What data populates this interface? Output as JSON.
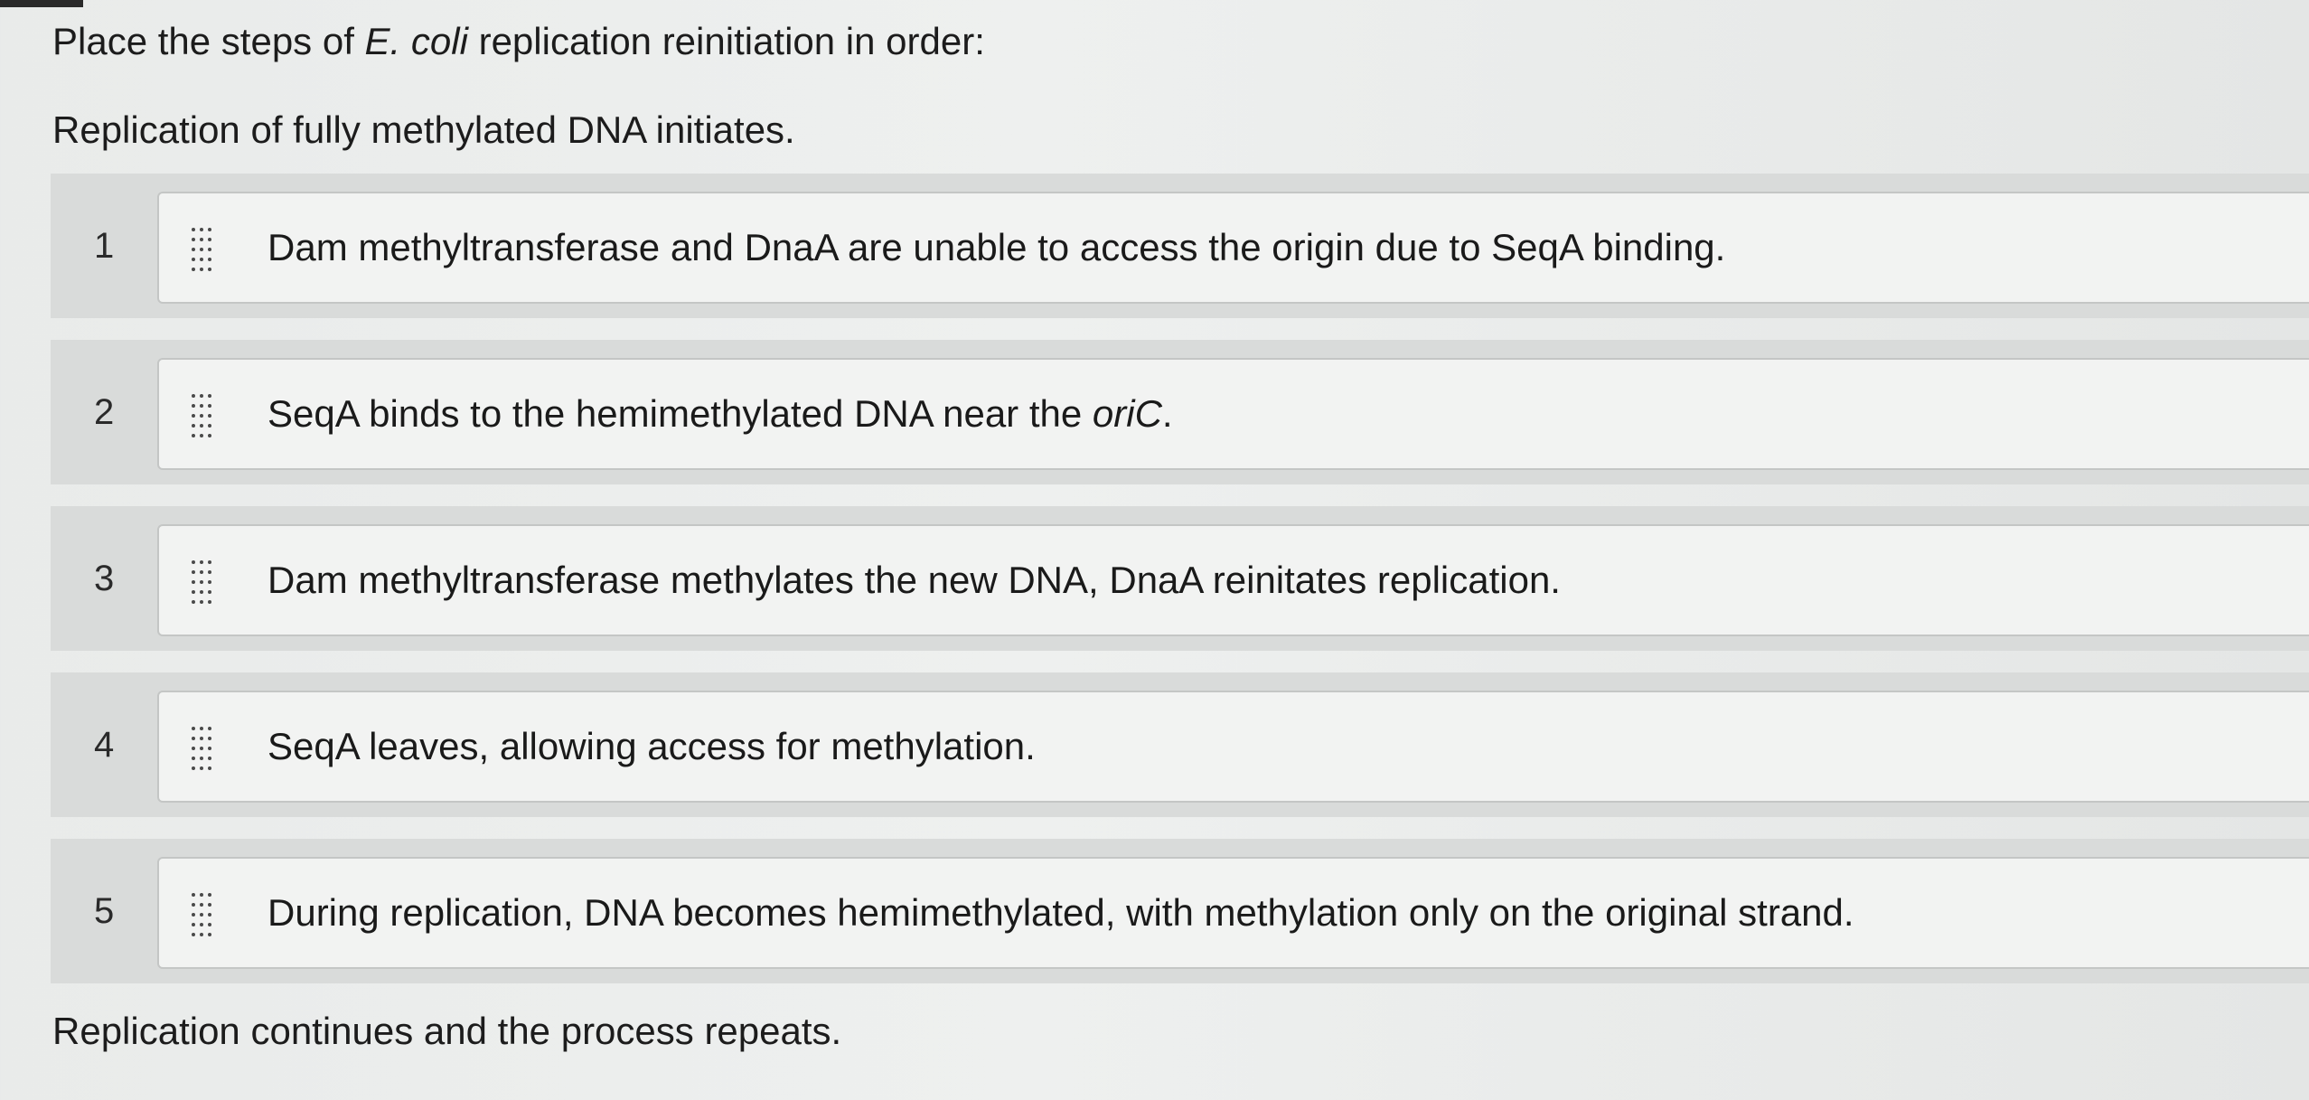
{
  "prompt": {
    "prefix": "Place the steps of ",
    "species": "E. coli",
    "suffix": " replication reinitiation in order:"
  },
  "intro": "Replication of fully methylated DNA initiates.",
  "steps": [
    {
      "number": "1",
      "text": "Dam methyltransferase and DnaA are unable to access the origin due to SeqA binding."
    },
    {
      "number": "2",
      "text": "SeqA binds to the hemimethylated DNA near the ",
      "italic_text": "oriC",
      "text_after": "."
    },
    {
      "number": "3",
      "text": "Dam methyltransferase methylates the new DNA, DnaA reinitates replication."
    },
    {
      "number": "4",
      "text": "SeqA leaves, allowing access for methylation."
    },
    {
      "number": "5",
      "text": "During replication, DNA becomes hemimethylated, with methylation only on the original strand."
    }
  ],
  "outro": "Replication continues and the process repeats.",
  "icons": {
    "drag_handle": "drag-handle-icon"
  }
}
